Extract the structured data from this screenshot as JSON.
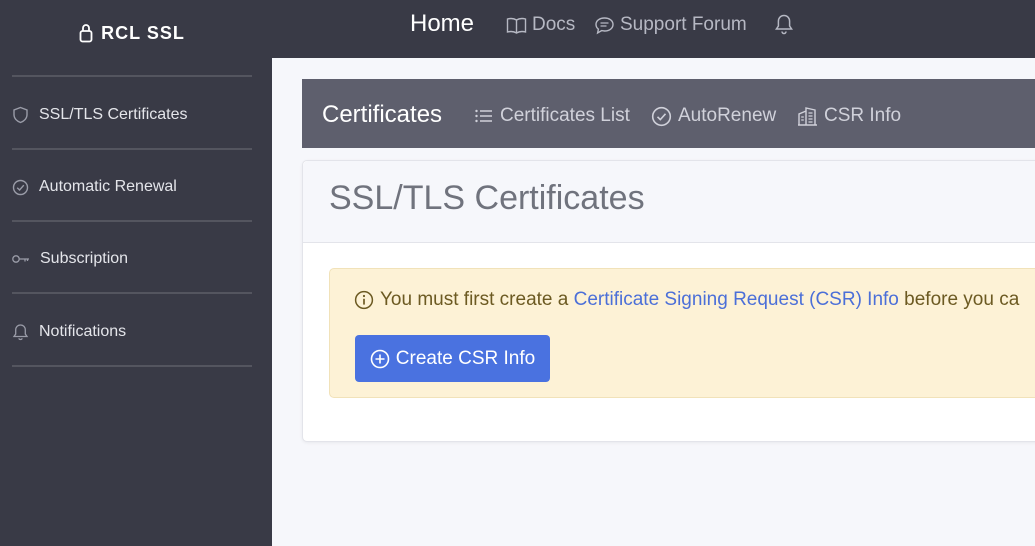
{
  "app": {
    "brand": "RCL SSL"
  },
  "sidebar": {
    "items": [
      {
        "label": "SSL/TLS Certificates",
        "icon": "shield-icon"
      },
      {
        "label": "Automatic Renewal",
        "icon": "check-circle-icon"
      },
      {
        "label": "Subscription",
        "icon": "key-icon"
      },
      {
        "label": "Notifications",
        "icon": "bell-icon"
      }
    ]
  },
  "topnav": {
    "home": "Home",
    "docs": "Docs",
    "forum": "Support Forum"
  },
  "subnav": {
    "title": "Certificates",
    "links": [
      "Certificates List",
      "AutoRenew",
      "CSR Info"
    ]
  },
  "main": {
    "card_title": "SSL/TLS Certificates",
    "alert": {
      "prefix": "You must first create a ",
      "link": "Certificate Signing Request (CSR) Info",
      "suffix": " before you ca"
    },
    "button": "Create CSR Info"
  },
  "colors": {
    "sidebar_bg": "#393a46",
    "subnav_bg": "#5e5f6d",
    "primary": "#4a72e0",
    "alert_bg": "#fdf2d6"
  }
}
